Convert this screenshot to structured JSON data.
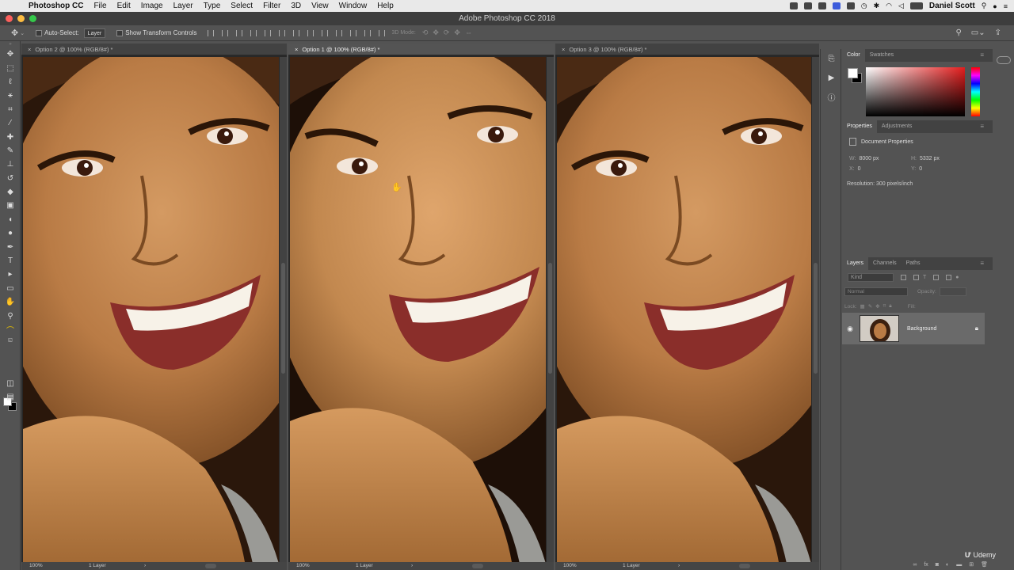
{
  "mac_menu": {
    "app": "Photoshop CC",
    "items": [
      "File",
      "Edit",
      "Image",
      "Layer",
      "Type",
      "Select",
      "Filter",
      "3D",
      "View",
      "Window",
      "Help"
    ],
    "user": "Daniel Scott"
  },
  "window_title": "Adobe Photoshop CC 2018",
  "options_bar": {
    "auto_select_label": "Auto-Select:",
    "auto_select_value": "Layer",
    "transform_label": "Show Transform Controls",
    "mode_3d_label": "3D Mode:"
  },
  "documents": [
    {
      "tab": "Option 2 @ 100% (RGB/8#) *",
      "zoom": "100%",
      "layers": "1 Layer",
      "active": false
    },
    {
      "tab": "Option 1 @ 100% (RGB/8#) *",
      "zoom": "100%",
      "layers": "1 Layer",
      "active": true
    },
    {
      "tab": "Option 3 @ 100% (RGB/8#) *",
      "zoom": "100%",
      "layers": "1 Layer",
      "active": false
    }
  ],
  "color_panel": {
    "tabs": [
      "Color",
      "Swatches"
    ]
  },
  "properties_panel": {
    "tabs": [
      "Properties",
      "Adjustments"
    ],
    "heading": "Document Properties",
    "w_label": "W:",
    "w": "8000 px",
    "h_label": "H:",
    "h": "5332 px",
    "x_label": "X:",
    "x": "0",
    "y_label": "Y:",
    "y": "0",
    "resolution": "Resolution: 300 pixels/inch"
  },
  "layers_panel": {
    "tabs": [
      "Layers",
      "Channels",
      "Paths"
    ],
    "kind_placeholder": "Kind",
    "blend_mode": "Normal",
    "opacity_label": "Opacity:",
    "lock_label": "Lock:",
    "fill_label": "Fill:",
    "layer_name": "Background"
  },
  "watermark": "Udemy",
  "colors": {
    "accent_red": "#e41d1d",
    "ui_dark": "#535353"
  }
}
